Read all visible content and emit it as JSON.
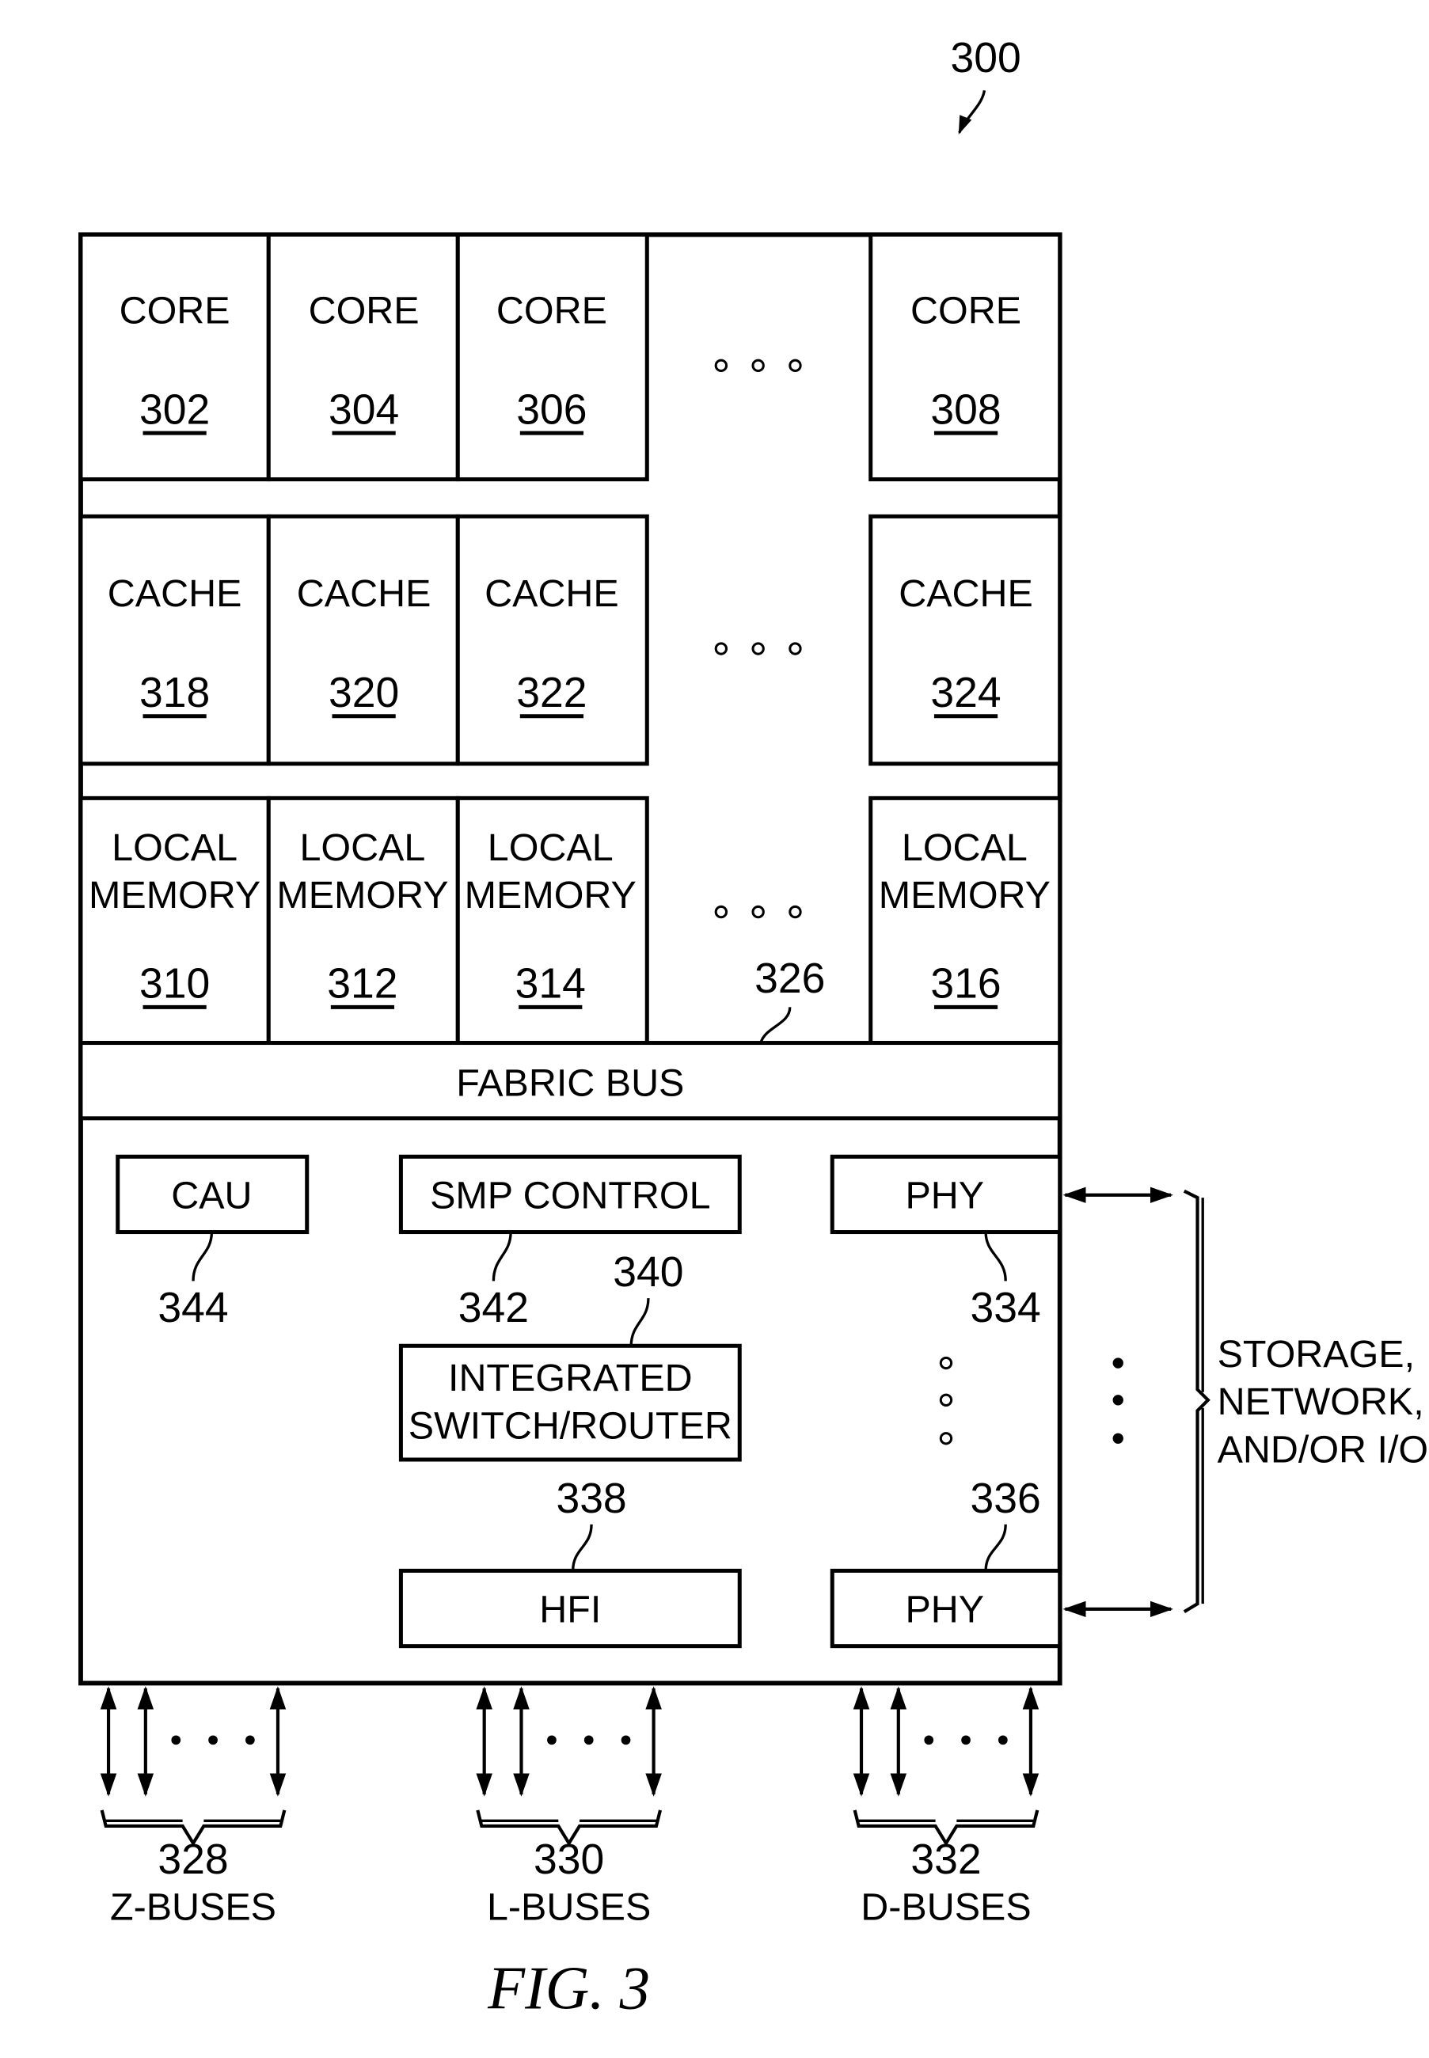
{
  "figure": {
    "ref": "300",
    "caption": "FIG. 3"
  },
  "cores": [
    {
      "label": "CORE",
      "ref": "302"
    },
    {
      "label": "CORE",
      "ref": "304"
    },
    {
      "label": "CORE",
      "ref": "306"
    },
    {
      "label": "CORE",
      "ref": "308"
    }
  ],
  "caches": [
    {
      "label": "CACHE",
      "ref": "318"
    },
    {
      "label": "CACHE",
      "ref": "320"
    },
    {
      "label": "CACHE",
      "ref": "322"
    },
    {
      "label": "CACHE",
      "ref": "324"
    }
  ],
  "memories": [
    {
      "line1": "LOCAL",
      "line2": "MEMORY",
      "ref": "310"
    },
    {
      "line1": "LOCAL",
      "line2": "MEMORY",
      "ref": "312"
    },
    {
      "line1": "LOCAL",
      "line2": "MEMORY",
      "ref": "314"
    },
    {
      "line1": "LOCAL",
      "line2": "MEMORY",
      "ref": "316"
    }
  ],
  "fabric_bus": {
    "label": "FABRIC BUS",
    "ref": "326"
  },
  "units": {
    "cau": {
      "label": "CAU",
      "ref": "344"
    },
    "smp": {
      "label": "SMP CONTROL",
      "ref": "342"
    },
    "switch": {
      "line1": "INTEGRATED",
      "line2": "SWITCH/ROUTER",
      "ref": "340"
    },
    "hfi": {
      "label": "HFI",
      "ref": "338"
    },
    "phy_top": {
      "label": "PHY",
      "ref": "334"
    },
    "phy_bottom": {
      "label": "PHY",
      "ref": "336"
    }
  },
  "external": {
    "line1": "STORAGE,",
    "line2": "NETWORK,",
    "line3": "AND/OR I/O"
  },
  "buses": [
    {
      "ref": "328",
      "label": "Z-BUSES"
    },
    {
      "ref": "330",
      "label": "L-BUSES"
    },
    {
      "ref": "332",
      "label": "D-BUSES"
    }
  ],
  "ellipsis": "• • •"
}
